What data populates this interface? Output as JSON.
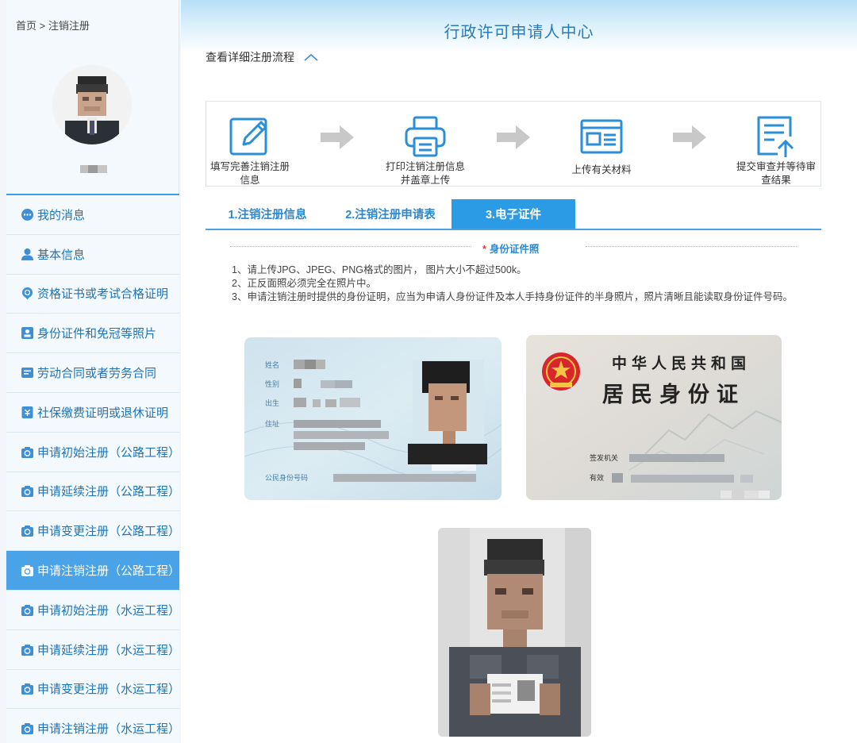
{
  "breadcrumb": "首页 > 注销注册",
  "app_title": "行政许可申请人中心",
  "flow_toggle_label": "查看详细注册流程",
  "steps": [
    {
      "label_line1": "填写完善注销注册",
      "label_line2": "信息",
      "icon": "edit-icon"
    },
    {
      "label_line1": "打印注销注册信息",
      "label_line2": "并盖章上传",
      "icon": "printer-icon"
    },
    {
      "label_line1": "上传有关材料",
      "label_line2": "",
      "icon": "document-card-icon"
    },
    {
      "label_line1": "提交审查并等待审",
      "label_line2": "查结果",
      "icon": "upload-document-icon"
    }
  ],
  "tabs": [
    {
      "label": "1.注销注册信息",
      "active": false
    },
    {
      "label": "2.注销注册申请表",
      "active": false
    },
    {
      "label": "3.电子证件",
      "active": true
    }
  ],
  "section": {
    "required_mark": "*",
    "title": "身份证件照"
  },
  "notes": [
    "1、请上传JPG、JPEG、PNG格式的图片， 图片大小不超过500k。",
    "2、正反面照必须完全在照片中。",
    "3、申请注销注册时提供的身份证明，应当为申请人身份证件及本人手持身份证件的半身照片，照片清晰且能读取身份证件号码。"
  ],
  "id_front": {
    "field_name": "姓名",
    "field_gender": "性别",
    "field_birth": "出生",
    "field_address": "住址",
    "field_number": "公民身份号码"
  },
  "id_back": {
    "country_title": "中华人民共和国",
    "card_title": "居民身份证",
    "field_issuer": "签发机关",
    "field_valid": "有效"
  },
  "menu": [
    {
      "label": "我的消息",
      "icon": "message-icon",
      "active": false
    },
    {
      "label": "基本信息",
      "icon": "user-icon",
      "active": false
    },
    {
      "label": "资格证书或考试合格证明",
      "icon": "certificate-icon",
      "active": false
    },
    {
      "label": "身份证件和免冠等照片",
      "icon": "id-photo-icon",
      "active": false
    },
    {
      "label": "劳动合同或者劳务合同",
      "icon": "contract-icon",
      "active": false
    },
    {
      "label": "社保缴费证明或退休证明",
      "icon": "social-security-icon",
      "active": false
    },
    {
      "label": "申请初始注册（公路工程）",
      "icon": "camera-icon",
      "active": false
    },
    {
      "label": "申请延续注册（公路工程）",
      "icon": "camera-icon",
      "active": false
    },
    {
      "label": "申请变更注册（公路工程）",
      "icon": "camera-icon",
      "active": false
    },
    {
      "label": "申请注销注册（公路工程）",
      "icon": "camera-icon",
      "active": true
    },
    {
      "label": "申请初始注册（水运工程）",
      "icon": "camera-icon",
      "active": false
    },
    {
      "label": "申请延续注册（水运工程）",
      "icon": "camera-icon",
      "active": false
    },
    {
      "label": "申请变更注册（水运工程）",
      "icon": "camera-icon",
      "active": false
    },
    {
      "label": "申请注销注册（水运工程）",
      "icon": "camera-icon",
      "active": false
    }
  ],
  "colors": {
    "accent": "#2b9be6",
    "sidebar_text": "#1f73b8",
    "header_title": "#2c7ab8",
    "required": "#e53935"
  }
}
